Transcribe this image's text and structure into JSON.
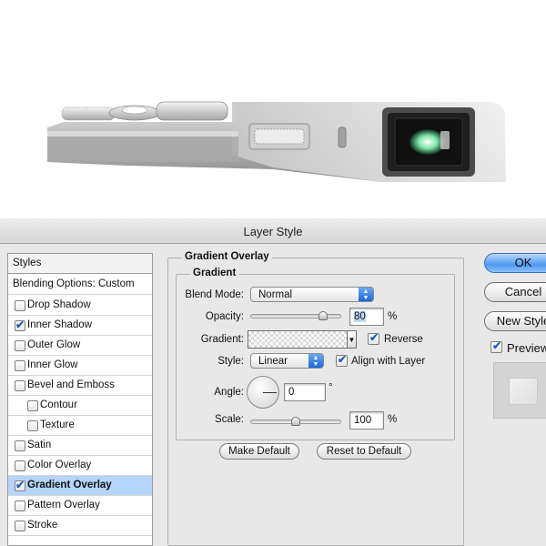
{
  "dialog": {
    "title": "Layer Style"
  },
  "styles_list": {
    "header": "Styles",
    "blending": "Blending Options: Custom",
    "items": [
      {
        "label": "Drop Shadow",
        "checked": false
      },
      {
        "label": "Inner Shadow",
        "checked": true
      },
      {
        "label": "Outer Glow",
        "checked": false
      },
      {
        "label": "Inner Glow",
        "checked": false
      },
      {
        "label": "Bevel and Emboss",
        "checked": false
      },
      {
        "label": "Contour",
        "checked": false
      },
      {
        "label": "Texture",
        "checked": false
      },
      {
        "label": "Satin",
        "checked": false
      },
      {
        "label": "Color Overlay",
        "checked": false
      },
      {
        "label": "Gradient Overlay",
        "checked": true
      },
      {
        "label": "Pattern Overlay",
        "checked": false
      },
      {
        "label": "Stroke",
        "checked": false
      }
    ],
    "selected_index": 9
  },
  "gradient_overlay": {
    "section_title": "Gradient Overlay",
    "group_title": "Gradient",
    "blend_mode_label": "Blend Mode:",
    "blend_mode_value": "Normal",
    "opacity_label": "Opacity:",
    "opacity_value": "80",
    "opacity_unit": "%",
    "opacity_fraction": 0.8,
    "gradient_label": "Gradient:",
    "reverse_label": "Reverse",
    "reverse_checked": true,
    "style_label": "Style:",
    "style_value": "Linear",
    "align_label": "Align with Layer",
    "align_checked": true,
    "angle_label": "Angle:",
    "angle_value": "0",
    "angle_unit": "°",
    "scale_label": "Scale:",
    "scale_value": "100",
    "scale_unit": "%",
    "scale_fraction": 0.5,
    "make_default": "Make Default",
    "reset_default": "Reset to Default"
  },
  "actions": {
    "ok": "OK",
    "cancel": "Cancel",
    "new_style": "New Style",
    "preview": "Preview",
    "preview_checked": true
  },
  "colors": {
    "selected_row": "#b5d5fb",
    "accent_blue": "#1c67d9",
    "dialog_bg": "#e8e8e8"
  }
}
